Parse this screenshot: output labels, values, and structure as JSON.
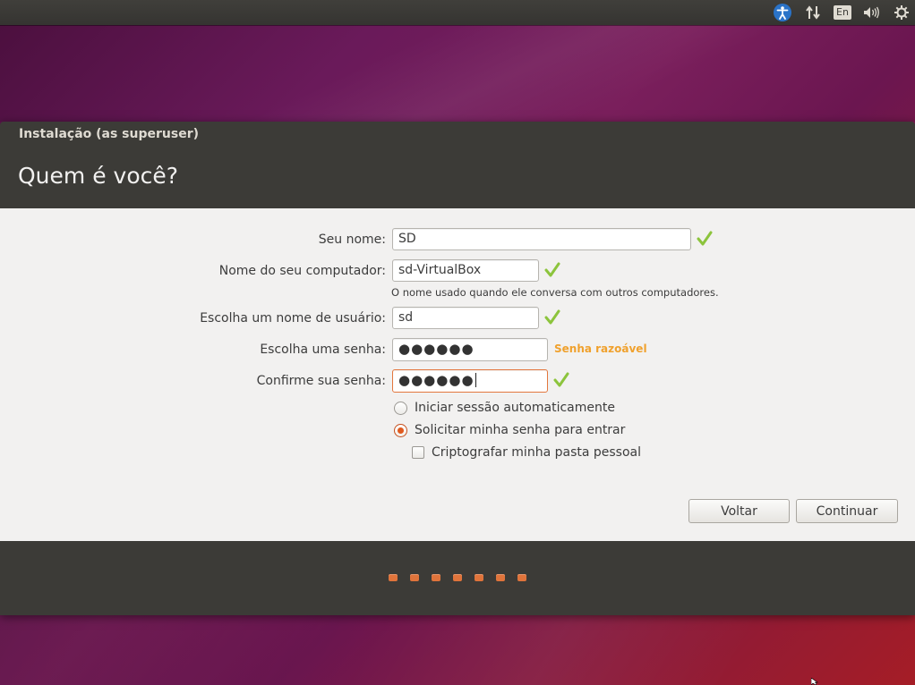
{
  "topbar": {
    "icons": [
      "accessibility-icon",
      "network-icon",
      "keyboard-layout-icon",
      "volume-icon",
      "power-gear-icon"
    ],
    "keyboard_layout": "En",
    "accent_color": "#2a73c8"
  },
  "window": {
    "title": "Instalação (as superuser)",
    "heading": "Quem é você?"
  },
  "form": {
    "name_label": "Seu nome:",
    "name_value": "SD",
    "computer_label": "Nome do seu computador:",
    "computer_value": "sd-VirtualBox",
    "computer_hint": "O nome usado quando ele conversa com outros computadores.",
    "username_label": "Escolha um nome de usuário:",
    "username_value": "sd",
    "password_label": "Escolha uma senha:",
    "password_value": "●●●●●●",
    "password_strength": "Senha razoável",
    "confirm_label": "Confirme sua senha:",
    "confirm_value": "●●●●●●",
    "options": {
      "auto_login": "Iniciar sessão automaticamente",
      "require_password": "Solicitar minha senha para entrar",
      "encrypt_home": "Criptografar minha pasta pessoal"
    },
    "selected_option": "require_password",
    "encrypt_checked": false
  },
  "buttons": {
    "back": "Voltar",
    "continue": "Continuar"
  },
  "progress": {
    "steps": 7,
    "color": "#e0743b"
  },
  "colors": {
    "check": "#8cc43c",
    "strength": "#f0a12d",
    "header": "#3c3b37",
    "content": "#f2f1f0"
  }
}
